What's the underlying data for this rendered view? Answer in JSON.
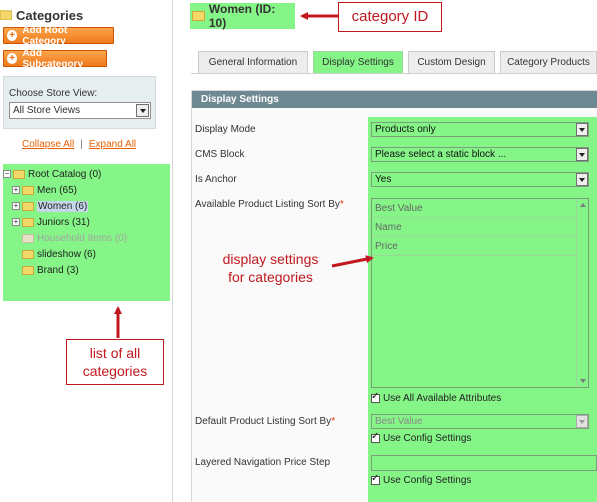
{
  "sidebar": {
    "title": "Categories",
    "add_root_label": "Add Root Category",
    "add_sub_label": "Add Subcategory",
    "store_view_label": "Choose Store View:",
    "store_view_value": "All Store Views",
    "collapse_all": "Collapse All",
    "separator": "|",
    "expand_all": "Expand All",
    "tree": [
      {
        "label": "Root Catalog (0)",
        "expander": "−",
        "state": "root"
      },
      {
        "label": "Men (65)",
        "expander": "+",
        "state": "normal"
      },
      {
        "label": "Women (6)",
        "expander": "+",
        "state": "selected"
      },
      {
        "label": "Juniors (31)",
        "expander": "+",
        "state": "normal"
      },
      {
        "label": "Household Items (0)",
        "expander": "",
        "state": "disabled"
      },
      {
        "label": "slideshow (6)",
        "expander": "",
        "state": "normal"
      },
      {
        "label": "Brand (3)",
        "expander": "",
        "state": "normal"
      }
    ]
  },
  "header": {
    "title": "Women (ID: 10)"
  },
  "tabs": [
    {
      "label": "General Information",
      "active": false
    },
    {
      "label": "Display Settings",
      "active": true
    },
    {
      "label": "Custom Design",
      "active": false
    },
    {
      "label": "Category Products",
      "active": false
    }
  ],
  "section": {
    "title": "Display Settings"
  },
  "form": {
    "display_mode_label": "Display Mode",
    "display_mode_value": "Products only",
    "cms_block_label": "CMS Block",
    "cms_block_value": "Please select a static block ...",
    "is_anchor_label": "Is Anchor",
    "is_anchor_value": "Yes",
    "sort_by_label": "Available Product Listing Sort By",
    "required_mark": "*",
    "sort_options": [
      "Best Value",
      "Name",
      "Price"
    ],
    "use_all_attributes_label": "Use All Available Attributes",
    "default_sort_label": "Default Product Listing Sort By",
    "default_sort_value": "Best Value",
    "use_config_label": "Use Config Settings",
    "price_step_label": "Layered Navigation Price Step",
    "price_step_value": "",
    "use_config_label_2": "Use Config Settings"
  },
  "annotations": {
    "category_id": "category ID",
    "display_settings_line1": "display settings",
    "display_settings_line2": "for categories",
    "list_line1": "list of all",
    "list_line2": "categories"
  },
  "colors": {
    "highlight": "#85f587",
    "annotation": "#c0181e",
    "accent": "#eb5e00",
    "section_header": "#6f8992"
  }
}
